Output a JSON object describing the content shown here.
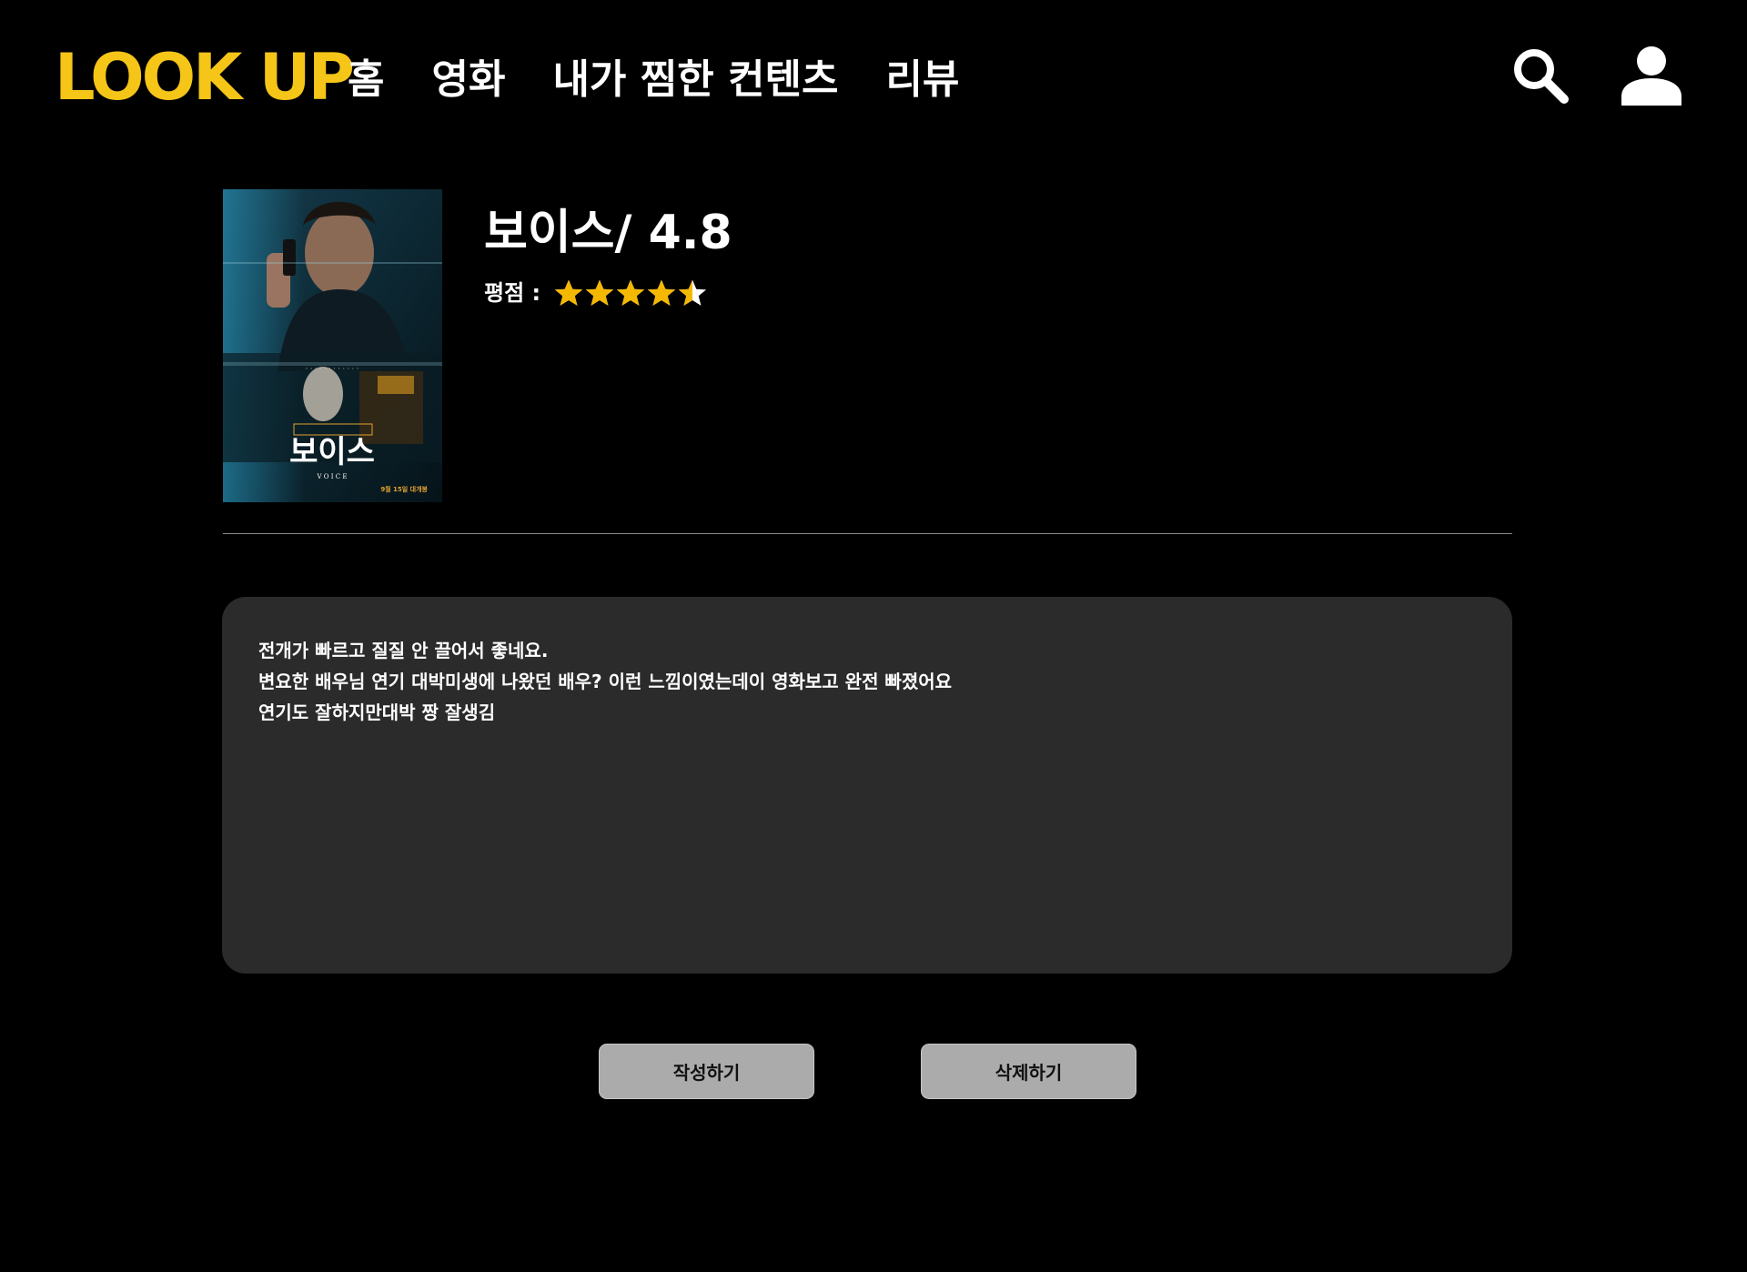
{
  "header": {
    "logo_text": "LOOK UP",
    "nav": [
      {
        "label": "홈"
      },
      {
        "label": "영화"
      },
      {
        "label": "내가 찜한 컨텐츠"
      },
      {
        "label": "리뷰"
      }
    ],
    "icons": {
      "search": "search-icon",
      "user": "user-icon"
    }
  },
  "movie": {
    "title": "보이스/ 4.8",
    "rating_label": "평점 :",
    "rating_value": 4.5,
    "rating_max": 5,
    "poster": {
      "title_text": "보이스",
      "subtitle_text": "V O I C E",
      "release_text": "9월 15일 대개봉"
    }
  },
  "review": {
    "lines": [
      "전개가 빠르고 질질 안 끌어서 좋네요.",
      "변요한 배우님 연기 대박미생에 나왔던 배우? 이런 느낌이였는데이 영화보고 완전 빠졌어요",
      "연기도 잘하지만대박 짱 잘생김"
    ]
  },
  "buttons": {
    "write": "작성하기",
    "delete": "삭제하기"
  },
  "colors": {
    "background": "#000000",
    "accent": "#f5c518",
    "star": "#f5b800",
    "review_bg": "#2b2b2b",
    "button_bg": "#ababab"
  }
}
